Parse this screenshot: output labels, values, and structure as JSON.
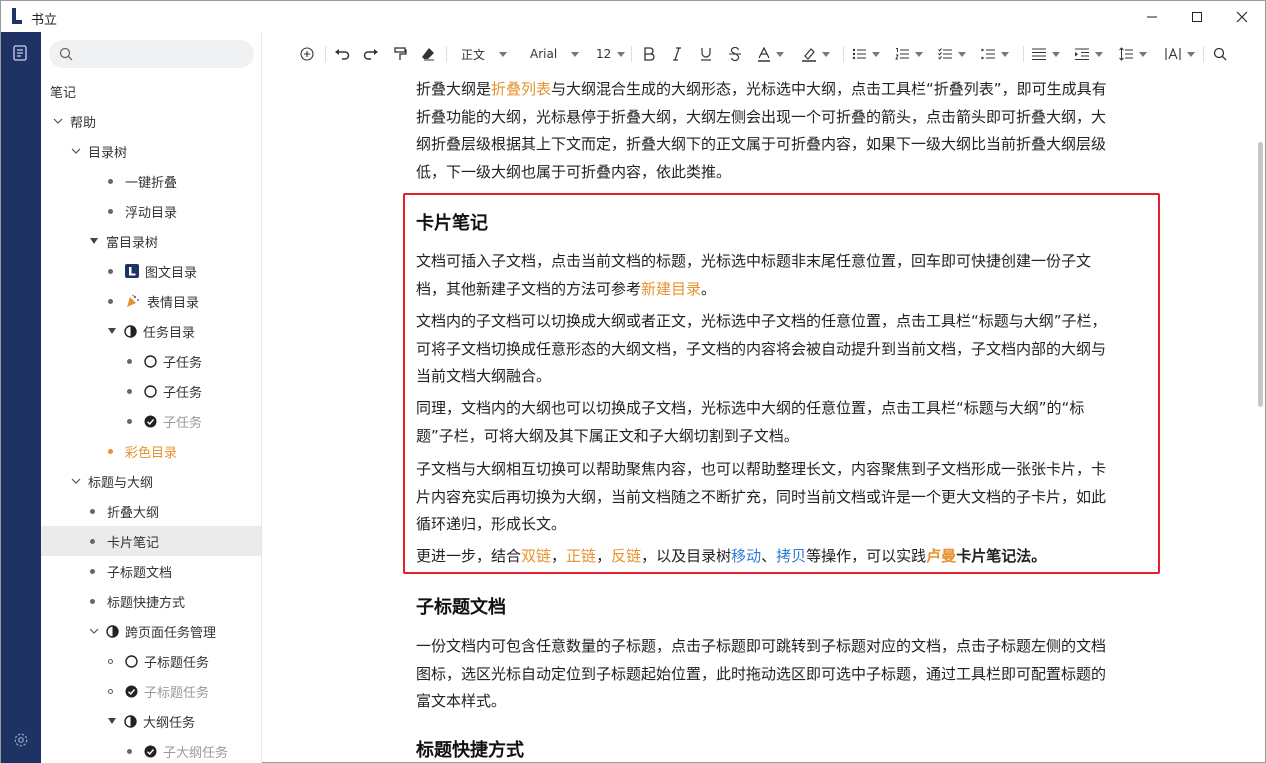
{
  "window": {
    "title": "书立"
  },
  "search": {
    "placeholder": ""
  },
  "sidebar": {
    "root": "笔记",
    "items": [
      {
        "label": "帮助"
      },
      {
        "label": "目录树"
      },
      {
        "label": "一键折叠"
      },
      {
        "label": "浮动目录"
      },
      {
        "label": "富目录树"
      },
      {
        "label": "图文目录"
      },
      {
        "label": "表情目录"
      },
      {
        "label": "任务目录"
      },
      {
        "label": "子任务"
      },
      {
        "label": "子任务"
      },
      {
        "label": "子任务"
      },
      {
        "label": "彩色目录"
      },
      {
        "label": "标题与大纲"
      },
      {
        "label": "折叠大纲"
      },
      {
        "label": "卡片笔记"
      },
      {
        "label": "子标题文档"
      },
      {
        "label": "标题快捷方式"
      },
      {
        "label": "跨页面任务管理"
      },
      {
        "label": "子标题任务"
      },
      {
        "label": "子标题任务"
      },
      {
        "label": "大纲任务"
      },
      {
        "label": "子大纲任务"
      }
    ]
  },
  "toolbar": {
    "paragraph_style": "正文",
    "font": "Arial",
    "size": "12"
  },
  "doc": {
    "p0": {
      "a": "折叠大纲是",
      "b": "折叠列表",
      "c": "与大纲混合生成的大纲形态，光标选中大纲，点击工具栏“折叠列表”，即可生成具有折叠功能的大纲，光标悬停于折叠大纲，大纲左侧会出现一个可折叠的箭头，点击箭头即可折叠大纲，大纲折叠层级根据其上下文而定，折叠大纲下的正文属于可折叠内容，如果下一级大纲比当前折叠大纲层级低，下一级大纲也属于可折叠内容，依此类推。"
    },
    "h_card": "卡片笔记",
    "p1": {
      "a": "文档可插入子文档，点击当前文档的标题，光标选中标题非末尾任意位置，回车即可快捷创建一份子文档，其他新建子文档的方法可参考",
      "b": "新建目录",
      "c": "。"
    },
    "p2": "文档内的子文档可以切换成大纲或者正文，光标选中子文档的任意位置，点击工具栏“标题与大纲”子栏，可将子文档切换成任意形态的大纲文档，子文档的内容将会被自动提升到当前文档，子文档内部的大纲与当前文档大纲融合。",
    "p3": "同理，文档内的大纲也可以切换成子文档，光标选中大纲的任意位置，点击工具栏“标题与大纲”的“标题”子栏，可将大纲及其下属正文和子大纲切割到子文档。",
    "p4": "子文档与大纲相互切换可以帮助聚焦内容，也可以帮助整理长文，内容聚焦到子文档形成一张张卡片，卡片内容充实后再切换为大纲，当前文档随之不断扩充，同时当前文档或许是一个更大文档的子卡片，如此循环递归，形成长文。",
    "p5": {
      "a": "更进一步，结合",
      "b": "双链",
      "c": "，",
      "d": "正链",
      "e": "，",
      "f": "反链",
      "g": "，以及目录树",
      "h": "移动",
      "i": "、",
      "j": "拷贝",
      "k": "等操作，可以实践",
      "l": "卢曼",
      "m": "卡片笔记法。"
    },
    "h_sub": "子标题文档",
    "p6": "一份文档内可包含任意数量的子标题，点击子标题即可跳转到子标题对应的文档，点击子标题左侧的文档图标，选区光标自动定位到子标题起始位置，此时拖动选区即可选中子标题，通过工具栏即可配置标题的富文本样式。",
    "h_shortcut": "标题快捷方式"
  },
  "colors": {
    "rail": "#1f3264",
    "accent_orange": "#e6922e",
    "link_blue": "#2d7ad6",
    "highlight_box": "#e5202a"
  }
}
